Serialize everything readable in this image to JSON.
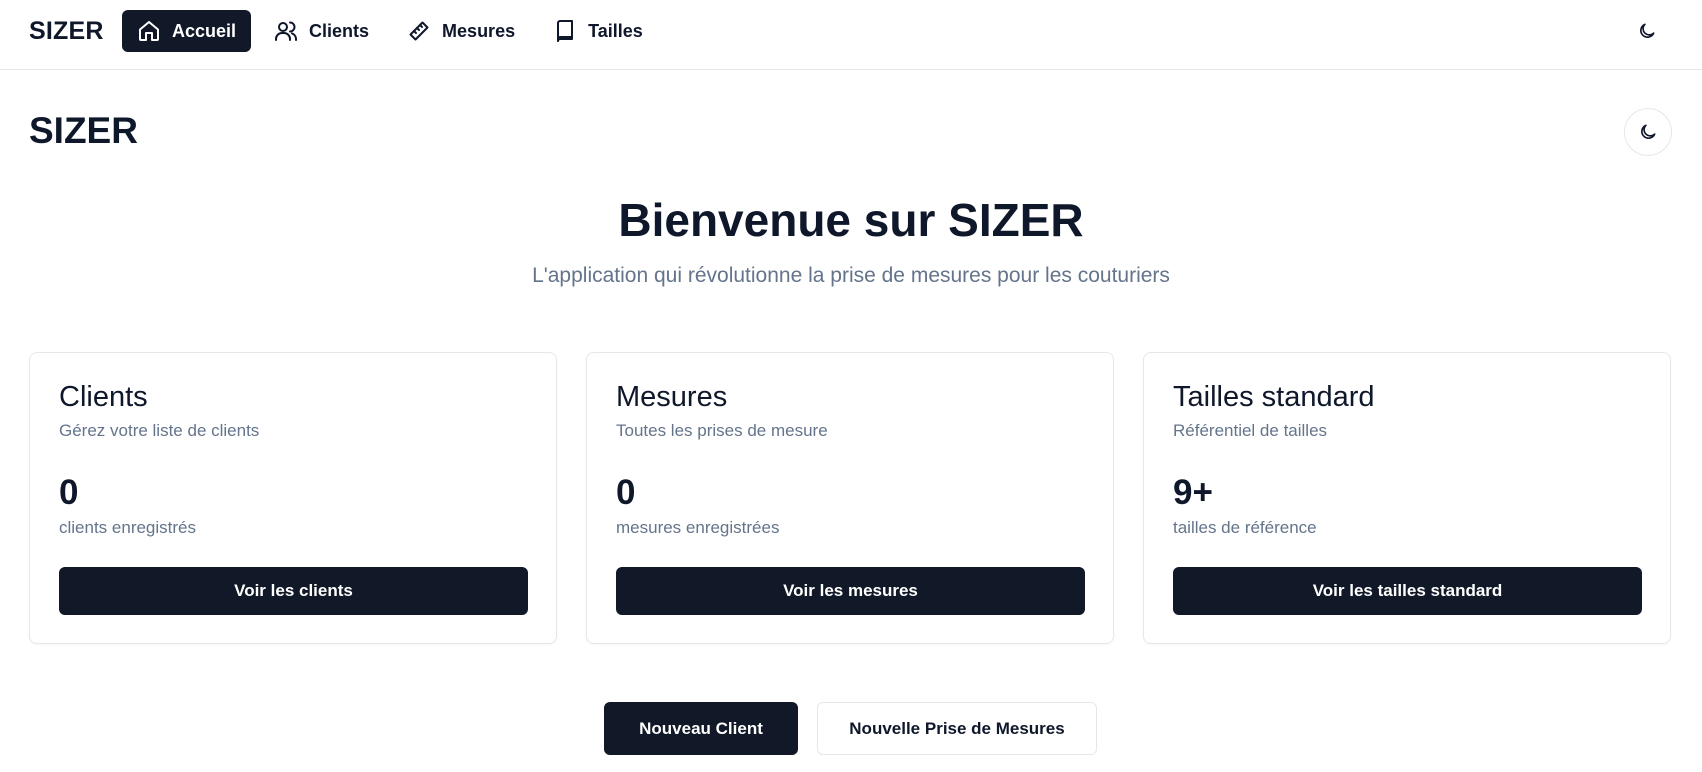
{
  "app": {
    "brand": "SIZER"
  },
  "nav": {
    "items": [
      {
        "label": "Accueil",
        "icon": "home-icon",
        "active": true
      },
      {
        "label": "Clients",
        "icon": "users-icon",
        "active": false
      },
      {
        "label": "Mesures",
        "icon": "ruler-icon",
        "active": false
      },
      {
        "label": "Tailles",
        "icon": "book-icon",
        "active": false
      }
    ],
    "theme_icon": "moon-icon"
  },
  "page": {
    "title": "SIZER",
    "theme_icon": "moon-icon"
  },
  "hero": {
    "title": "Bienvenue sur SIZER",
    "subtitle": "L'application qui révolutionne la prise de mesures pour les couturiers"
  },
  "cards": [
    {
      "title": "Clients",
      "description": "Gérez votre liste de clients",
      "count": "0",
      "unit": "clients enregistrés",
      "button": "Voir les clients"
    },
    {
      "title": "Mesures",
      "description": "Toutes les prises de mesure",
      "count": "0",
      "unit": "mesures enregistrées",
      "button": "Voir les mesures"
    },
    {
      "title": "Tailles standard",
      "description": "Référentiel de tailles",
      "count": "9+",
      "unit": "tailles de référence",
      "button": "Voir les tailles standard"
    }
  ],
  "actions": {
    "primary": "Nouveau Client",
    "secondary": "Nouvelle Prise de Mesures"
  },
  "colors": {
    "primary": "#111827",
    "text": "#0f172a",
    "muted": "#64748b",
    "border": "#e5e7eb"
  }
}
